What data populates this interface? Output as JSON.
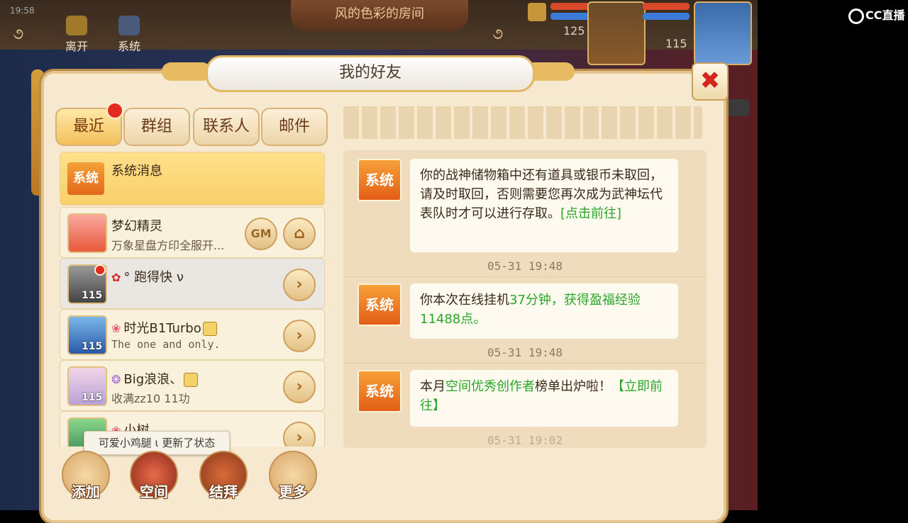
{
  "hud": {
    "clock": "19:58",
    "room_title": "风的色彩的房间",
    "leave_label": "离开",
    "system_label": "系统",
    "player1_level": "125",
    "player2_level": "115"
  },
  "watermark": "CC直播",
  "dialog": {
    "title": "我的好友",
    "close_symbol": "✖"
  },
  "tabs": [
    {
      "label": "最近",
      "active": true
    },
    {
      "label": "群组",
      "active": false
    },
    {
      "label": "联系人",
      "active": false
    },
    {
      "label": "邮件",
      "active": false
    }
  ],
  "friends": [
    {
      "name": "系统消息",
      "sub": "",
      "badge": "系统"
    },
    {
      "name": "梦幻精灵",
      "sub": "万象星盘方印全服开...",
      "gm": "GM",
      "action": "⌂"
    },
    {
      "name": "°  跑得快 ν",
      "sub": "",
      "level": "115",
      "action": "›"
    },
    {
      "name": "时光B1Turbo",
      "sub": "The one and only.",
      "level": "115",
      "action": "›"
    },
    {
      "name": "Big浪浪、",
      "sub": "收满zz10 11功",
      "level": "115",
      "action": "›"
    },
    {
      "name": "小树",
      "sub": "",
      "level": "",
      "action": "›"
    }
  ],
  "status_tip": "可爱小鸡腿 ι 更新了状态",
  "bottom_buttons": [
    {
      "label": "添加"
    },
    {
      "label": "空间"
    },
    {
      "label": "结拜"
    },
    {
      "label": "更多"
    }
  ],
  "messages": [
    {
      "sender": "系统",
      "text_a": "你的战神储物箱中还有道具或银币未取回，请及时取回，否则需要您再次成为武神坛代表队时才可以进行存取。",
      "text_link": "[点击前往]",
      "time": "05-31 19:48"
    },
    {
      "sender": "系统",
      "text_a": "你本次在线挂机",
      "text_b": "37分钟，获得盈福经验11488点。",
      "time": "05-31 19:48"
    },
    {
      "sender": "系统",
      "text_a": "本月",
      "text_b": "空间优秀创作者",
      "text_c": "榜单出炉啦！",
      "text_link": "【立即前往】",
      "time": "05-31 19:02"
    }
  ],
  "colors": {
    "accent": "#f3c05a",
    "link_green": "#2aa52a",
    "alert_red": "#e22a1e"
  }
}
